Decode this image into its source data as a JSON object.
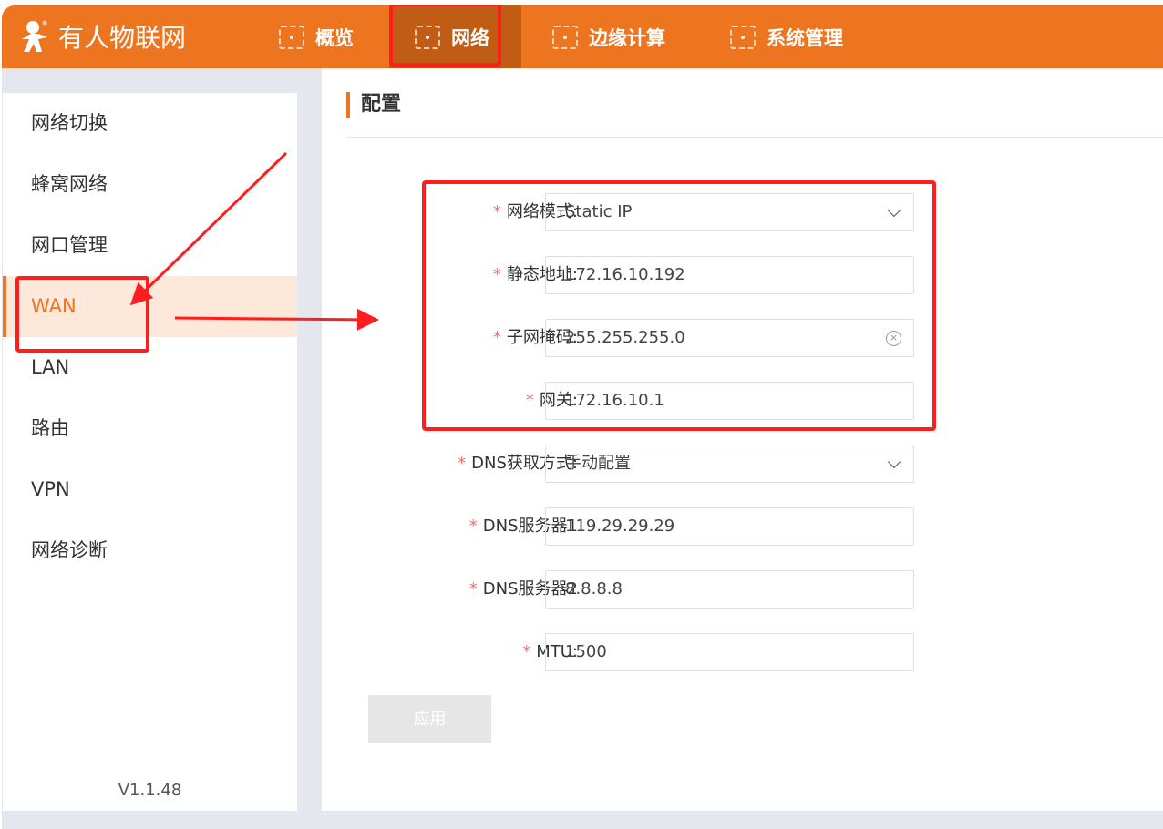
{
  "header": {
    "brand": "有人物联网",
    "nav": [
      "概览",
      "网络",
      "边缘计算",
      "系统管理"
    ],
    "active_nav": "网络"
  },
  "sidebar": {
    "items": [
      "网络切换",
      "蜂窝网络",
      "网口管理",
      "WAN",
      "LAN",
      "路由",
      "VPN",
      "网络诊断"
    ],
    "active": "WAN",
    "version": "V1.1.48"
  },
  "main": {
    "title": "配置",
    "fields": [
      {
        "label": "网络模式:",
        "value": "Static IP",
        "type": "select"
      },
      {
        "label": "静态地址:",
        "value": "172.16.10.192",
        "type": "input"
      },
      {
        "label": "子网掩码:",
        "value": "255.255.255.0",
        "type": "input-clear"
      },
      {
        "label": "网关:",
        "value": "172.16.10.1",
        "type": "input"
      },
      {
        "label": "DNS获取方式:",
        "value": "手动配置",
        "type": "select"
      },
      {
        "label": "DNS服务器1",
        "value": "119.29.29.29",
        "type": "input"
      },
      {
        "label": "DNS服务器2",
        "value": "8.8.8.8",
        "type": "input"
      },
      {
        "label": "MTU:",
        "value": "1500",
        "type": "input"
      }
    ],
    "required_mark": "*",
    "apply_label": "应用"
  },
  "colors": {
    "brand": "#ee7520",
    "annotation": "#ff1e1e"
  }
}
